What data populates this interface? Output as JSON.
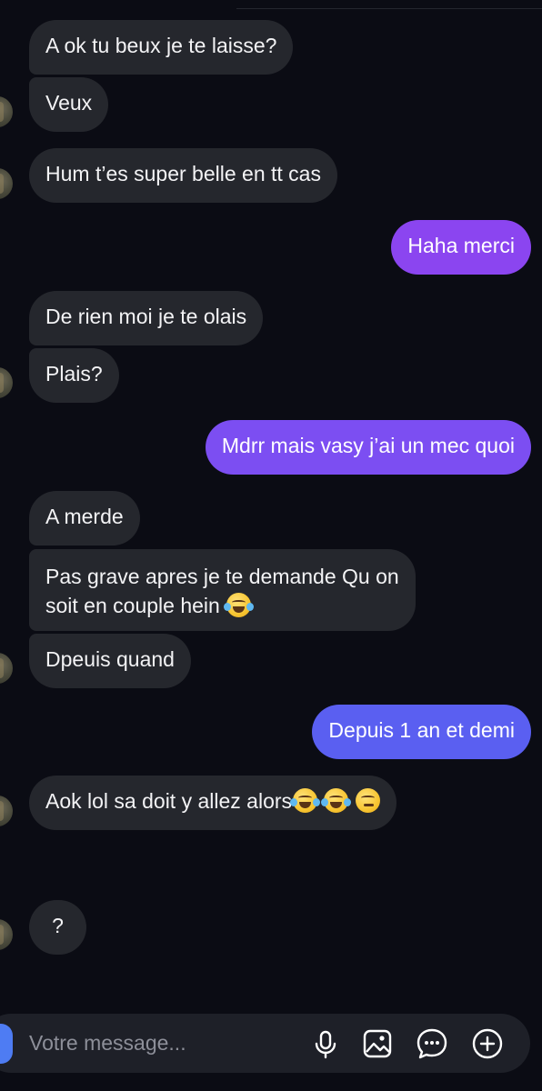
{
  "messages": [
    {
      "side": "in",
      "text": "A ok tu beux je te laisse?"
    },
    {
      "side": "in",
      "text": "Veux"
    },
    {
      "side": "in",
      "text": "Hum t’es super belle en tt cas"
    },
    {
      "side": "out",
      "text": "Haha merci",
      "color": "#8b45f0"
    },
    {
      "side": "in",
      "text": "De rien moi je te olais"
    },
    {
      "side": "in",
      "text": "Plais?"
    },
    {
      "side": "out",
      "text": "Mdrr mais vasy j’ai un mec quoi",
      "color": "#7c4ef2"
    },
    {
      "side": "in",
      "text": "A merde"
    },
    {
      "side": "in",
      "line1": "Pas grave apres je te demande Qu on",
      "line2": "soit en couple hein"
    },
    {
      "side": "in",
      "text": "Dpeuis quand"
    },
    {
      "side": "out",
      "text": "Depuis 1 an et demi",
      "color": "#5a5ff1"
    },
    {
      "side": "in",
      "text": "Aok lol sa doit y allez alors"
    },
    {
      "side": "in",
      "text": "?"
    }
  ],
  "emojis": {
    "couple_message": [
      "face-with-tears-of-joy-icon"
    ],
    "aok_message": [
      "face-with-tears-of-joy-icon",
      "face-with-tears-of-joy-icon",
      "smirking-face-icon"
    ]
  },
  "composer": {
    "placeholder": "Votre message...",
    "icons": [
      "microphone-icon",
      "image-icon",
      "sticker-chat-icon",
      "plus-circle-icon"
    ]
  },
  "colors": {
    "background": "#0b0c14",
    "incoming_bubble": "#25272d",
    "outgoing_purple": "#8b45f0",
    "outgoing_violet": "#7c4ef2",
    "outgoing_blue": "#5a5ff1"
  }
}
